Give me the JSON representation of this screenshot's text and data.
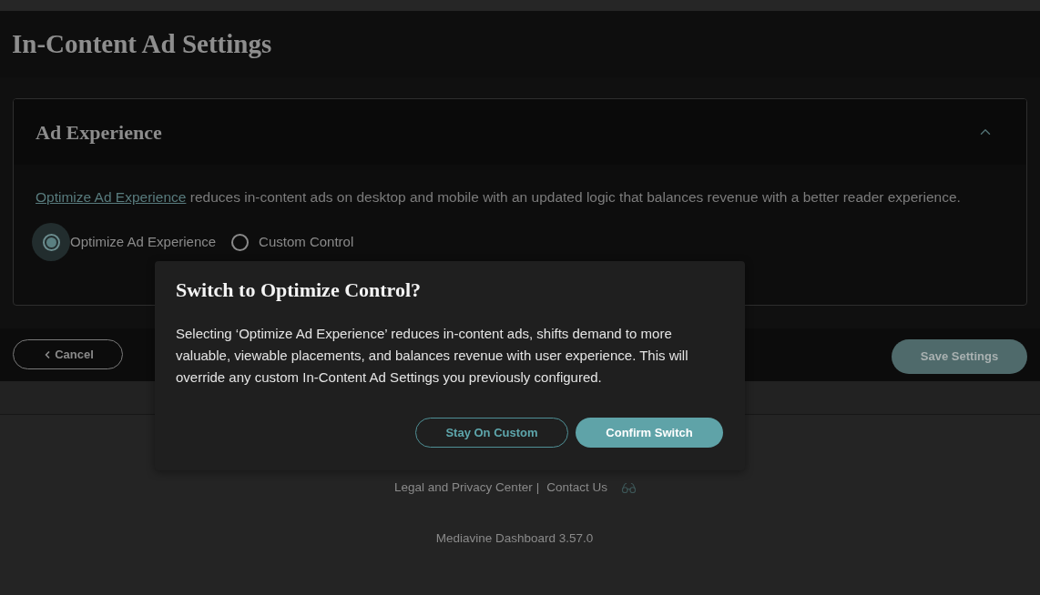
{
  "page": {
    "title": "In-Content Ad Settings"
  },
  "section": {
    "title": "Ad Experience",
    "expanded": true,
    "description": {
      "link": "Optimize Ad Experience",
      "text": "reduces in-content ads on desktop and mobile with an updated logic that balances revenue with a better reader experience."
    },
    "options": [
      {
        "label": "Optimize Ad Experience",
        "selected": true
      },
      {
        "label": "Custom Control",
        "selected": false
      }
    ]
  },
  "actions": {
    "cancel": {
      "label": "Cancel"
    },
    "save": {
      "label": "Save Settings",
      "disabled": true
    }
  },
  "footer": {
    "links": [
      "Legal and Privacy Center",
      "Contact Us"
    ],
    "separator": "|",
    "version": "Mediavine Dashboard 3.57.0"
  },
  "dialog": {
    "title": "Switch to Optimize Control?",
    "body": "Selecting ‘Optimize Ad Experience’ reduces in-content ads, shifts demand to more valuable, viewable placements, and balances revenue with user experience. This will override any custom In-Content Ad Settings you previously configured.",
    "buttons": [
      {
        "label": "Stay On Custom",
        "kind": "secondary"
      },
      {
        "label": "Confirm Switch",
        "kind": "primary"
      }
    ]
  }
}
